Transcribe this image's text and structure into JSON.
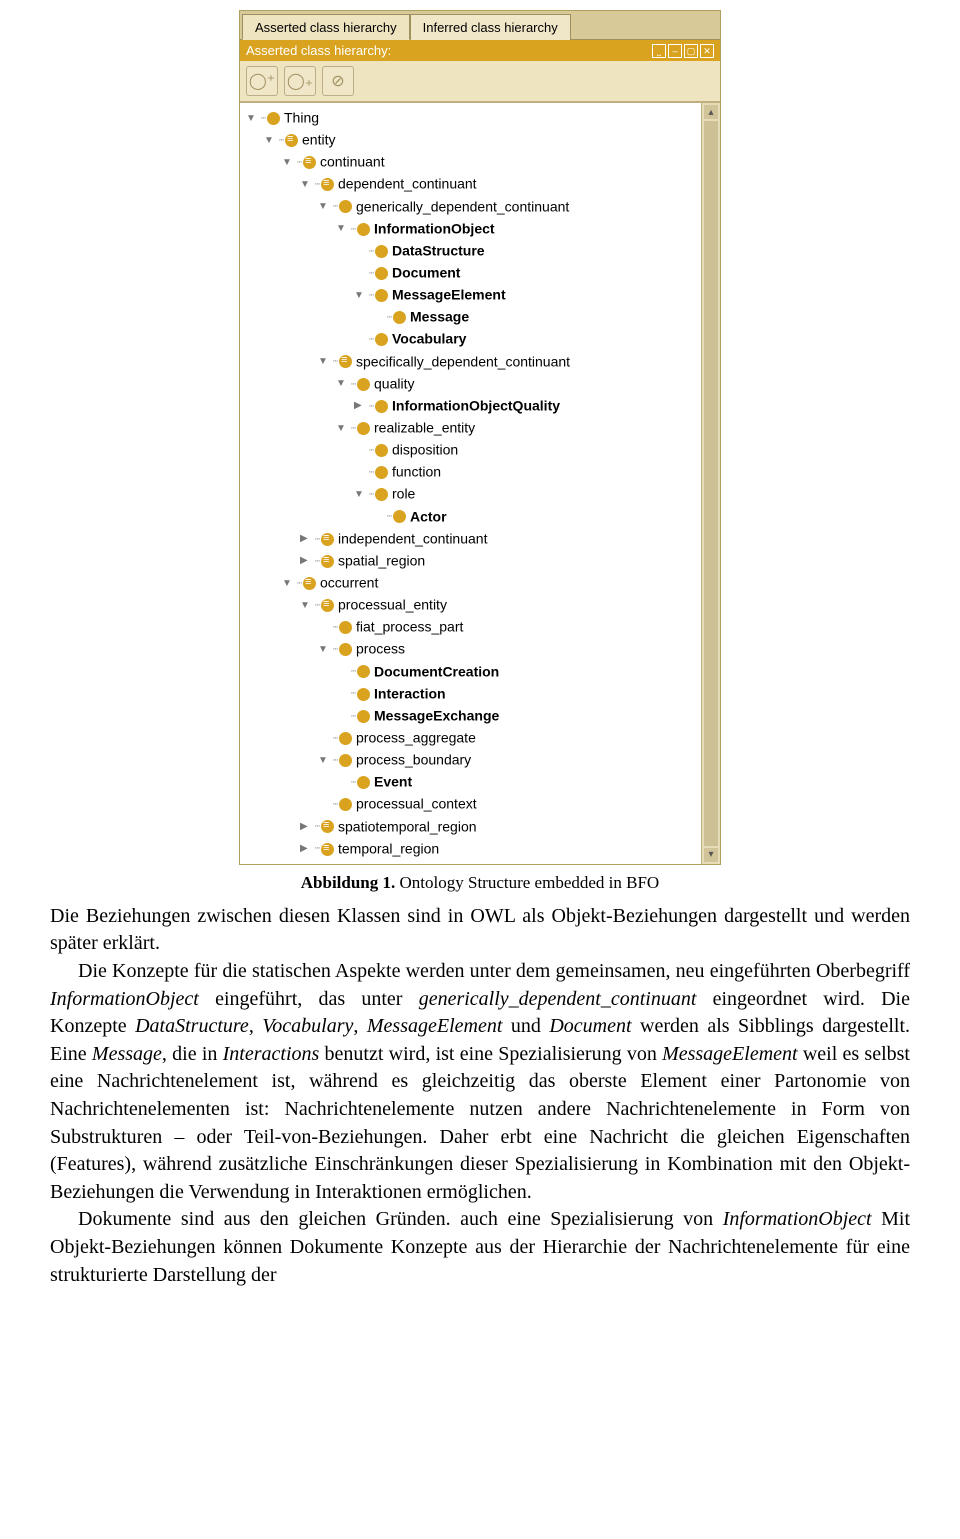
{
  "figure": {
    "tabs": {
      "active": "Asserted class hierarchy",
      "inactive": "Inferred class hierarchy"
    },
    "panel_title": "Asserted class hierarchy:",
    "tree": {
      "thing": "Thing",
      "entity": "entity",
      "continuant": "continuant",
      "dep_cont": "dependent_continuant",
      "gen_dep": "generically_dependent_continuant",
      "info_obj": "InformationObject",
      "data_struct": "DataStructure",
      "document": "Document",
      "msg_elem": "MessageElement",
      "message": "Message",
      "vocab": "Vocabulary",
      "spec_dep": "specifically_dependent_continuant",
      "quality": "quality",
      "info_obj_q": "InformationObjectQuality",
      "realizable": "realizable_entity",
      "disposition": "disposition",
      "function": "function",
      "role": "role",
      "actor": "Actor",
      "indep_cont": "independent_continuant",
      "spatial": "spatial_region",
      "occurrent": "occurrent",
      "proc_entity": "processual_entity",
      "fiat": "fiat_process_part",
      "process": "process",
      "doc_create": "DocumentCreation",
      "interaction": "Interaction",
      "msg_exch": "MessageExchange",
      "proc_agg": "process_aggregate",
      "proc_bound": "process_boundary",
      "event": "Event",
      "proc_ctx": "processual_context",
      "spatiotemp": "spatiotemporal_region",
      "temporal": "temporal_region"
    }
  },
  "caption": {
    "label": "Abbildung 1.",
    "text": " Ontology Structure embedded in BFO"
  },
  "para": {
    "p1": "Die Beziehungen zwischen diesen Klassen sind in OWL als Objekt-Beziehungen dargestellt und werden später erklärt.",
    "p2a": "Die Konzepte für die statischen Aspekte werden unter dem gemeinsamen, neu eingeführten Oberbegriff ",
    "p2_io": "InformationObject",
    "p2b": " eingeführt, das unter ",
    "p2_gdc": "generically_dependent_continuant",
    "p2c": " eingeordnet wird. Die Konzepte ",
    "p2_ds": "DataStructure",
    "p2d": ", ",
    "p2_voc": "Vocabulary",
    "p2e": ", ",
    "p2_me": "MessageElement",
    "p2f": " und ",
    "p2_doc": "Document",
    "p2g": " werden als Sibblings dargestellt. Eine ",
    "p2_msg": "Message",
    "p2h": ", die in ",
    "p2_int": "Interactions",
    "p2i": " benutzt wird, ist eine Spezialisierung von ",
    "p2_me2": "MessageElement",
    "p2j": " weil es selbst eine Nachrichtenelement ist, während es gleichzeitig das oberste Element einer Partonomie von Nachrichtenelementen ist: Nachrichten­elemente nutzen andere Nachrichtenelemente in Form von Substrukturen – oder Teil-von-Beziehungen. Daher erbt eine Nachricht die gleichen Eigenschaften (Features), während zusätzliche Einschränkungen dieser Spezialisierung in Kombination mit den Objekt-Beziehungen die Verwendung in Interaktionen ermöglichen.",
    "p3a": "Dokumente sind aus den gleichen Gründen. auch eine Spezialisierung von ",
    "p3_io": "InformationObject",
    "p3b": " Mit Objekt-Beziehungen können Dokumente Konzepte aus der Hierarchie der Nachrichtenelemente für eine strukturierte Darstellung der"
  }
}
